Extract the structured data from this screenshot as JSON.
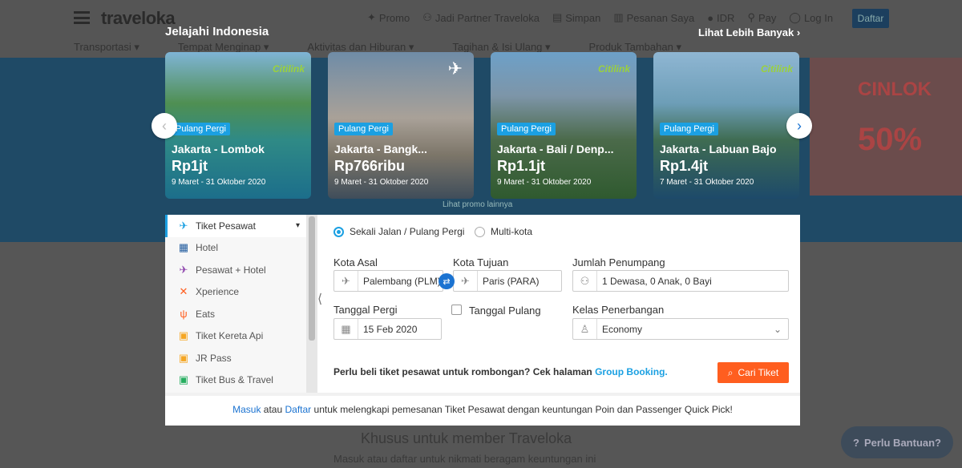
{
  "header": {
    "logo": "traveloka",
    "nav": [
      "Promo",
      "Jadi Partner Traveloka",
      "Simpan",
      "Pesanan Saya",
      "IDR",
      "Pay",
      "Log In"
    ],
    "daftar": "Daftar",
    "subnav": [
      "Transportasi",
      "Tempat Menginap",
      "Aktivitas dan Hiburan",
      "Tagihan & Isi Ulang",
      "Produk Tambahan"
    ]
  },
  "promo_side": {
    "line1": "CINLOK",
    "line2": "50%"
  },
  "modal": {
    "title": "Jelajahi Indonesia",
    "see_more": "Lihat Lebih Banyak",
    "below_cards": "Lihat promo lainnya",
    "cards": [
      {
        "badge": "Pulang Pergi",
        "route": "Jakarta - Lombok",
        "price": "Rp1jt",
        "date": "9 Maret - 31 Oktober 2020",
        "brand": "Citilink"
      },
      {
        "badge": "Pulang Pergi",
        "route": "Jakarta - Bangk...",
        "price": "Rp766ribu",
        "date": "9 Maret - 31 Oktober 2020",
        "brand": ""
      },
      {
        "badge": "Pulang Pergi",
        "route": "Jakarta - Bali / Denp...",
        "price": "Rp1.1jt",
        "date": "9 Maret - 31 Oktober 2020",
        "brand": "Citilink"
      },
      {
        "badge": "Pulang Pergi",
        "route": "Jakarta - Labuan Bajo",
        "price": "Rp1.4jt",
        "date": "7 Maret - 31 Oktober 2020",
        "brand": "Citilink"
      }
    ]
  },
  "sidebar": {
    "items": [
      {
        "label": "Tiket Pesawat",
        "icon": "airplane-icon",
        "color": "#1ba0e2"
      },
      {
        "label": "Hotel",
        "icon": "hotel-icon",
        "color": "#235d9f"
      },
      {
        "label": "Pesawat + Hotel",
        "icon": "plane-hotel-icon",
        "color": "#8e44ad"
      },
      {
        "label": "Xperience",
        "icon": "xperience-icon",
        "color": "#ff5e1f"
      },
      {
        "label": "Eats",
        "icon": "eats-icon",
        "color": "#ff5e1f"
      },
      {
        "label": "Tiket Kereta Api",
        "icon": "train-icon",
        "color": "#f5a623"
      },
      {
        "label": "JR Pass",
        "icon": "jr-pass-icon",
        "color": "#f5a623"
      },
      {
        "label": "Tiket Bus & Travel",
        "icon": "bus-icon",
        "color": "#27ae60"
      }
    ]
  },
  "form": {
    "trip_oneway": "Sekali Jalan / Pulang Pergi",
    "trip_multi": "Multi-kota",
    "origin_label": "Kota Asal",
    "origin_value": "Palembang (PLM)",
    "dest_label": "Kota Tujuan",
    "dest_value": "Paris (PARA)",
    "passengers_label": "Jumlah Penumpang",
    "passengers_value": "1 Dewasa, 0 Anak, 0 Bayi",
    "depart_label": "Tanggal Pergi",
    "depart_value": "15 Feb 2020",
    "return_label": "Tanggal Pulang",
    "class_label": "Kelas Penerbangan",
    "class_value": "Economy",
    "group_text": "Perlu beli tiket pesawat untuk rombongan? Cek halaman",
    "group_link": "Group Booking.",
    "search_button": "Cari Tiket"
  },
  "bottom_note": {
    "login": "Masuk",
    "atau": "atau",
    "daftar": "Daftar",
    "rest": "untuk melengkapi pemesanan Tiket Pesawat dengan keuntungan Poin dan Passenger Quick Pick!"
  },
  "page_bottom": {
    "heading": "Khusus untuk member Traveloka",
    "sub": "Masuk atau daftar untuk nikmati beragam keuntungan ini"
  },
  "help": "Perlu Bantuan?"
}
